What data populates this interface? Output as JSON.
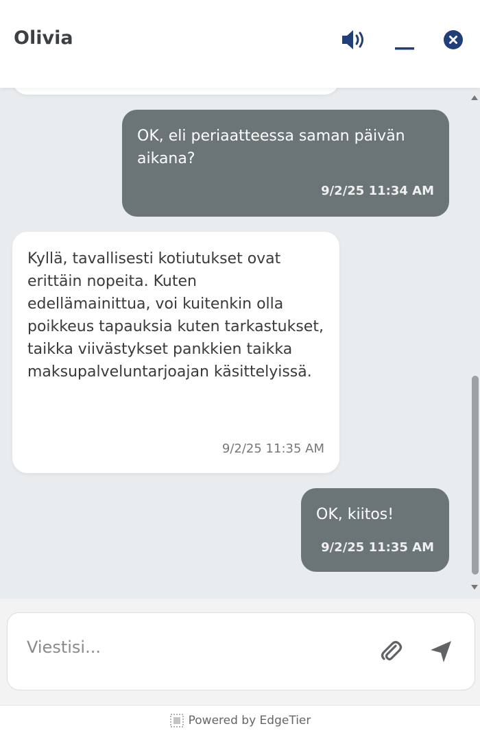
{
  "header": {
    "agent_name": "Olivia"
  },
  "messages": [
    {
      "sender": "user",
      "text": "OK, eli periaatteessa saman päivän aikana?",
      "time": "9/2/25 11:34 AM"
    },
    {
      "sender": "agent",
      "text": "Kyllä, tavallisesti kotiutukset ovat erittäin nopeita. Kuten edellämainittua, voi kuitenkin olla poikkeus tapauksia kuten tarkastukset, taikka viivästykset pankkien taikka maksupalveluntarjoajan käsittelyissä.",
      "time": "9/2/25 11:35 AM"
    },
    {
      "sender": "user",
      "text": "OK, kiitos!",
      "time": "9/2/25 11:35 AM"
    }
  ],
  "composer": {
    "placeholder": "Viestisi..."
  },
  "footer": {
    "text": "Powered by EdgeTier"
  },
  "icons": {
    "sound": "speaker-icon",
    "minimize": "minimize-icon",
    "close": "close-icon",
    "attach": "paperclip-icon",
    "send": "send-icon"
  },
  "colors": {
    "accent": "#1f3e7a",
    "user_bubble": "#6b7577",
    "chat_bg": "#e9ecee"
  }
}
